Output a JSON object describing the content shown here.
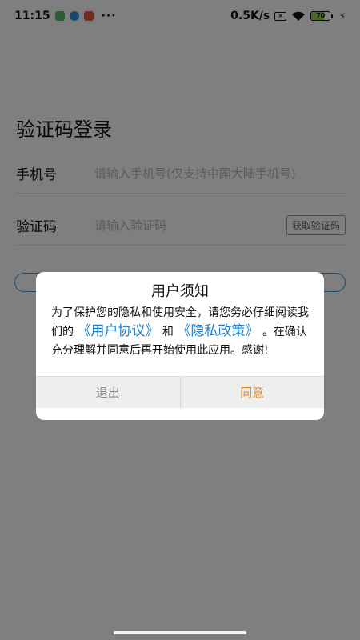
{
  "status_bar": {
    "time": "11:15",
    "more": "···",
    "network_speed": "0.5K/s",
    "sim_icon": "sim-x-icon",
    "battery_level": "70",
    "app_icons": [
      {
        "name": "wechat-notify-icon",
        "color": "#5cb85c"
      },
      {
        "name": "message-notify-icon",
        "color": "#2a8fe0"
      },
      {
        "name": "app-notify-icon",
        "color": "#e8553c"
      }
    ]
  },
  "login": {
    "title": "验证码登录",
    "phone_label": "手机号",
    "phone_placeholder": "请输入手机号(仅支持中国大陆手机号)",
    "code_label": "验证码",
    "code_placeholder": "请输入验证码",
    "get_code_label": "获取验证码"
  },
  "dialog": {
    "title": "用户须知",
    "text_1": "为了保护您的隐私和使用安全，请您务必仔细阅读我们的",
    "link_agreement": "《用户协议》",
    "text_and": "和",
    "link_privacy": "《隐私政策》",
    "text_2": "。在确认充分理解并同意后再开始使用此应用。感谢!",
    "exit_label": "退出",
    "agree_label": "同意"
  },
  "colors": {
    "accent": "#1e7fc6",
    "agree": "#d9882a",
    "exit": "#8a8a8a",
    "login_border": "#3a9bd8"
  }
}
